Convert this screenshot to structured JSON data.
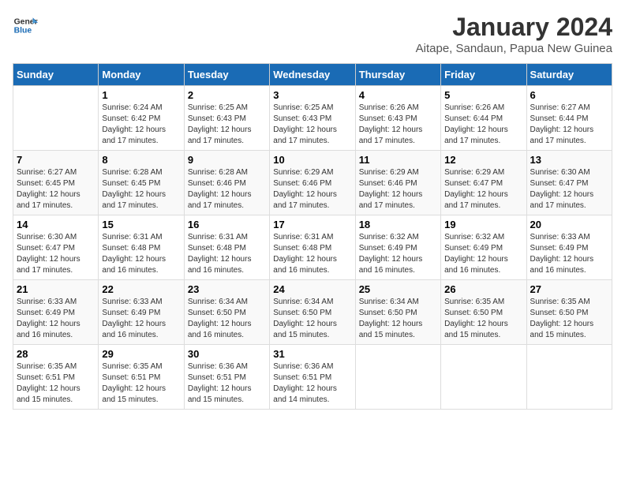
{
  "logo": {
    "text_general": "General",
    "text_blue": "Blue"
  },
  "title": "January 2024",
  "subtitle": "Aitape, Sandaun, Papua New Guinea",
  "days_of_week": [
    "Sunday",
    "Monday",
    "Tuesday",
    "Wednesday",
    "Thursday",
    "Friday",
    "Saturday"
  ],
  "weeks": [
    [
      {
        "day": "",
        "info": ""
      },
      {
        "day": "1",
        "info": "Sunrise: 6:24 AM\nSunset: 6:42 PM\nDaylight: 12 hours\nand 17 minutes."
      },
      {
        "day": "2",
        "info": "Sunrise: 6:25 AM\nSunset: 6:43 PM\nDaylight: 12 hours\nand 17 minutes."
      },
      {
        "day": "3",
        "info": "Sunrise: 6:25 AM\nSunset: 6:43 PM\nDaylight: 12 hours\nand 17 minutes."
      },
      {
        "day": "4",
        "info": "Sunrise: 6:26 AM\nSunset: 6:43 PM\nDaylight: 12 hours\nand 17 minutes."
      },
      {
        "day": "5",
        "info": "Sunrise: 6:26 AM\nSunset: 6:44 PM\nDaylight: 12 hours\nand 17 minutes."
      },
      {
        "day": "6",
        "info": "Sunrise: 6:27 AM\nSunset: 6:44 PM\nDaylight: 12 hours\nand 17 minutes."
      }
    ],
    [
      {
        "day": "7",
        "info": "Sunrise: 6:27 AM\nSunset: 6:45 PM\nDaylight: 12 hours\nand 17 minutes."
      },
      {
        "day": "8",
        "info": "Sunrise: 6:28 AM\nSunset: 6:45 PM\nDaylight: 12 hours\nand 17 minutes."
      },
      {
        "day": "9",
        "info": "Sunrise: 6:28 AM\nSunset: 6:46 PM\nDaylight: 12 hours\nand 17 minutes."
      },
      {
        "day": "10",
        "info": "Sunrise: 6:29 AM\nSunset: 6:46 PM\nDaylight: 12 hours\nand 17 minutes."
      },
      {
        "day": "11",
        "info": "Sunrise: 6:29 AM\nSunset: 6:46 PM\nDaylight: 12 hours\nand 17 minutes."
      },
      {
        "day": "12",
        "info": "Sunrise: 6:29 AM\nSunset: 6:47 PM\nDaylight: 12 hours\nand 17 minutes."
      },
      {
        "day": "13",
        "info": "Sunrise: 6:30 AM\nSunset: 6:47 PM\nDaylight: 12 hours\nand 17 minutes."
      }
    ],
    [
      {
        "day": "14",
        "info": "Sunrise: 6:30 AM\nSunset: 6:47 PM\nDaylight: 12 hours\nand 17 minutes."
      },
      {
        "day": "15",
        "info": "Sunrise: 6:31 AM\nSunset: 6:48 PM\nDaylight: 12 hours\nand 16 minutes."
      },
      {
        "day": "16",
        "info": "Sunrise: 6:31 AM\nSunset: 6:48 PM\nDaylight: 12 hours\nand 16 minutes."
      },
      {
        "day": "17",
        "info": "Sunrise: 6:31 AM\nSunset: 6:48 PM\nDaylight: 12 hours\nand 16 minutes."
      },
      {
        "day": "18",
        "info": "Sunrise: 6:32 AM\nSunset: 6:49 PM\nDaylight: 12 hours\nand 16 minutes."
      },
      {
        "day": "19",
        "info": "Sunrise: 6:32 AM\nSunset: 6:49 PM\nDaylight: 12 hours\nand 16 minutes."
      },
      {
        "day": "20",
        "info": "Sunrise: 6:33 AM\nSunset: 6:49 PM\nDaylight: 12 hours\nand 16 minutes."
      }
    ],
    [
      {
        "day": "21",
        "info": "Sunrise: 6:33 AM\nSunset: 6:49 PM\nDaylight: 12 hours\nand 16 minutes."
      },
      {
        "day": "22",
        "info": "Sunrise: 6:33 AM\nSunset: 6:49 PM\nDaylight: 12 hours\nand 16 minutes."
      },
      {
        "day": "23",
        "info": "Sunrise: 6:34 AM\nSunset: 6:50 PM\nDaylight: 12 hours\nand 16 minutes."
      },
      {
        "day": "24",
        "info": "Sunrise: 6:34 AM\nSunset: 6:50 PM\nDaylight: 12 hours\nand 15 minutes."
      },
      {
        "day": "25",
        "info": "Sunrise: 6:34 AM\nSunset: 6:50 PM\nDaylight: 12 hours\nand 15 minutes."
      },
      {
        "day": "26",
        "info": "Sunrise: 6:35 AM\nSunset: 6:50 PM\nDaylight: 12 hours\nand 15 minutes."
      },
      {
        "day": "27",
        "info": "Sunrise: 6:35 AM\nSunset: 6:50 PM\nDaylight: 12 hours\nand 15 minutes."
      }
    ],
    [
      {
        "day": "28",
        "info": "Sunrise: 6:35 AM\nSunset: 6:51 PM\nDaylight: 12 hours\nand 15 minutes."
      },
      {
        "day": "29",
        "info": "Sunrise: 6:35 AM\nSunset: 6:51 PM\nDaylight: 12 hours\nand 15 minutes."
      },
      {
        "day": "30",
        "info": "Sunrise: 6:36 AM\nSunset: 6:51 PM\nDaylight: 12 hours\nand 15 minutes."
      },
      {
        "day": "31",
        "info": "Sunrise: 6:36 AM\nSunset: 6:51 PM\nDaylight: 12 hours\nand 14 minutes."
      },
      {
        "day": "",
        "info": ""
      },
      {
        "day": "",
        "info": ""
      },
      {
        "day": "",
        "info": ""
      }
    ]
  ]
}
